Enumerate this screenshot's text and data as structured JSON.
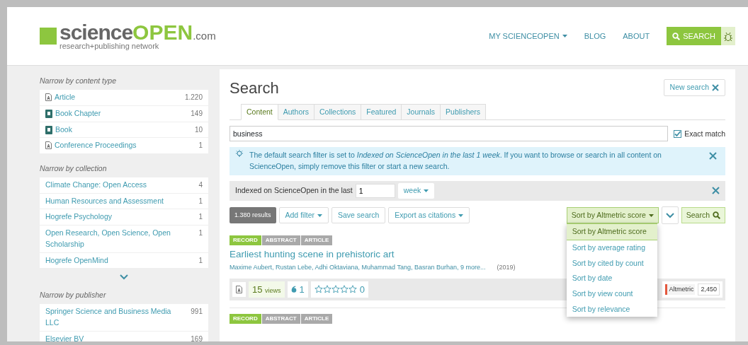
{
  "header": {
    "logo": {
      "main": "science",
      "accent": "OPEN",
      "suffix": ".com",
      "tagline": "research+publishing network"
    },
    "nav": [
      {
        "label": "MY SCIENCEOPEN",
        "dropdown": true
      },
      {
        "label": "BLOG",
        "dropdown": false
      },
      {
        "label": "ABOUT",
        "dropdown": false
      }
    ],
    "search_button": "SEARCH"
  },
  "sidebar": [
    {
      "title": "Narrow by content type",
      "more": false,
      "items": [
        {
          "label": "Article",
          "count": "1.220",
          "kind": "article"
        },
        {
          "label": "Book Chapter",
          "count": "149",
          "kind": "book"
        },
        {
          "label": "Book",
          "count": "10",
          "kind": "book"
        },
        {
          "label": "Conference Proceedings",
          "count": "1",
          "kind": "article"
        }
      ]
    },
    {
      "title": "Narrow by collection",
      "more": true,
      "items": [
        {
          "label": "Climate Change: Open Access",
          "count": "4",
          "kind": "collection"
        },
        {
          "label": "Human Resources and Assessment",
          "count": "1",
          "kind": "collection"
        },
        {
          "label": "Hogrefe Psychology",
          "count": "1",
          "kind": "collection"
        },
        {
          "label": "Open Research, Open Science, Open Scholarship",
          "count": "1",
          "kind": "collection"
        },
        {
          "label": "Hogrefe OpenMind",
          "count": "1",
          "kind": "collection"
        }
      ]
    },
    {
      "title": "Narrow by publisher",
      "more": false,
      "items": [
        {
          "label": "Springer Science and Business Media LLC",
          "count": "991",
          "kind": "publisher"
        },
        {
          "label": "Elsevier BV",
          "count": "169",
          "kind": "publisher"
        }
      ]
    }
  ],
  "main": {
    "title": "Search",
    "new_search": "New search",
    "tabs": [
      {
        "label": "Content",
        "selected": true
      },
      {
        "label": "Authors",
        "selected": false
      },
      {
        "label": "Collections",
        "selected": false
      },
      {
        "label": "Featured",
        "selected": false
      },
      {
        "label": "Journals",
        "selected": false
      },
      {
        "label": "Publishers",
        "selected": false
      }
    ],
    "query": "business",
    "exact_match": {
      "label": "Exact match",
      "checked": true
    },
    "notice": "The default search filter is set to *Indexed on ScienceOpen in the last 1 week*. If you want to browse or search in all content on ScienceOpen, simply remove this filter or start a new search.",
    "filter": {
      "label": "Indexed on ScienceOpen in the last",
      "value": "1",
      "unit": "week"
    },
    "results_count": "1.380 results",
    "actions": [
      {
        "label": "Add filter",
        "dropdown": true
      },
      {
        "label": "Save search",
        "dropdown": false
      },
      {
        "label": "Export as citations",
        "dropdown": true
      }
    ],
    "sort": {
      "label": "Sort by Altmetric score",
      "expanded": true,
      "options": [
        {
          "label": "Sort by Altmetric score",
          "selected": true
        },
        {
          "label": "Sort by average rating",
          "selected": false
        },
        {
          "label": "Sort by cited by count",
          "selected": false
        },
        {
          "label": "Sort by date",
          "selected": false
        },
        {
          "label": "Sort by view count",
          "selected": false
        },
        {
          "label": "Sort by relevance",
          "selected": false
        }
      ]
    },
    "search_button": "Search",
    "results": [
      {
        "tags": [
          {
            "label": "RECORD",
            "selected": true
          },
          {
            "label": "ABSTRACT",
            "selected": false
          },
          {
            "label": "ARTICLE",
            "selected": false
          }
        ],
        "title": "Earliest hunting scene in prehistoric art",
        "authors": "Maxime Aubert, Rustan Lebe, Adhi Oktaviana, Muhammad Tang, Basran Burhan, 9 more...",
        "year": "(2019)",
        "views": "15",
        "views_label": "views",
        "citations": "1",
        "stars": 0,
        "rating_count": "0",
        "altmetric": {
          "label": "Altmetric",
          "score": "2,450"
        }
      },
      {
        "tags": [
          {
            "label": "RECORD",
            "selected": true
          },
          {
            "label": "ABSTRACT",
            "selected": false
          },
          {
            "label": "ARTICLE",
            "selected": false
          }
        ]
      }
    ]
  }
}
